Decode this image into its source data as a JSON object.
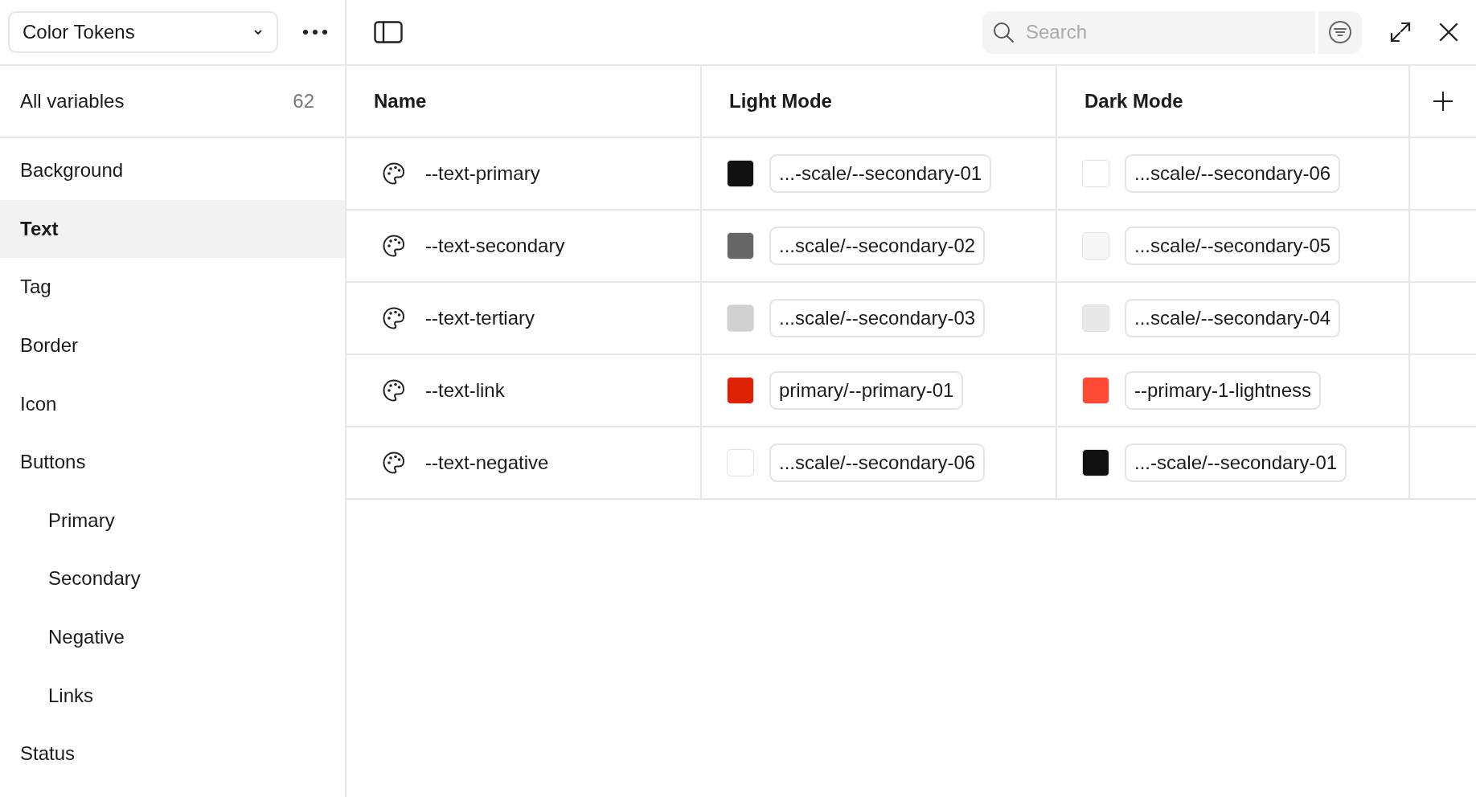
{
  "toolbar": {
    "collection": "Color Tokens",
    "search": {
      "placeholder": "Search"
    }
  },
  "sidebar": {
    "all": {
      "label": "All variables",
      "count": "62"
    },
    "items": [
      {
        "label": "Background",
        "selected": false
      },
      {
        "label": "Text",
        "selected": true
      },
      {
        "label": "Tag",
        "selected": false
      },
      {
        "label": "Border",
        "selected": false
      },
      {
        "label": "Icon",
        "selected": false
      },
      {
        "label": "Buttons",
        "selected": false,
        "children": [
          {
            "label": "Primary",
            "selected": false
          },
          {
            "label": "Secondary",
            "selected": false
          },
          {
            "label": "Negative",
            "selected": false
          },
          {
            "label": "Links",
            "selected": false
          }
        ]
      },
      {
        "label": "Status",
        "selected": false
      }
    ]
  },
  "table": {
    "columns": [
      "Name",
      "Light Mode",
      "Dark Mode"
    ],
    "rows": [
      {
        "name": "--text-primary",
        "light": {
          "color": "#111111",
          "value": "...-scale/--secondary-01"
        },
        "dark": {
          "color": "#ffffff",
          "value": "...scale/--secondary-06"
        }
      },
      {
        "name": "--text-secondary",
        "light": {
          "color": "#666666",
          "value": "...scale/--secondary-02"
        },
        "dark": {
          "color": "#f7f7f7",
          "value": "...scale/--secondary-05"
        }
      },
      {
        "name": "--text-tertiary",
        "light": {
          "color": "#d1d1d1",
          "value": "...scale/--secondary-03"
        },
        "dark": {
          "color": "#e8e8e8",
          "value": "...scale/--secondary-04"
        }
      },
      {
        "name": "--text-link",
        "light": {
          "color": "#dd2105",
          "value": "primary/--primary-01"
        },
        "dark": {
          "color": "#fd4a34",
          "value": "--primary-1-lightness"
        }
      },
      {
        "name": "--text-negative",
        "light": {
          "color": "#ffffff",
          "value": "...scale/--secondary-06"
        },
        "dark": {
          "color": "#111111",
          "value": "...-scale/--secondary-01"
        }
      }
    ]
  }
}
